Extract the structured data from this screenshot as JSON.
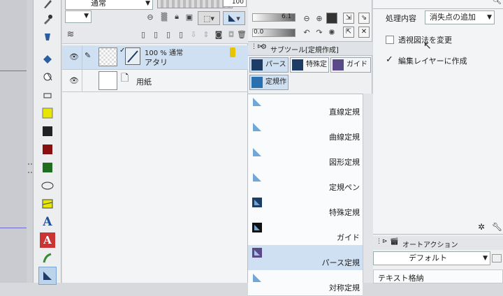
{
  "layers_panel": {
    "blend_mode": "通常",
    "opacity_value": "100",
    "layers": [
      {
        "percent_mode": "100 % 通常",
        "name": "アタリ",
        "selected": true
      },
      {
        "name": "用紙",
        "selected": false
      }
    ]
  },
  "subtool_panel": {
    "slider_value": "6.1",
    "slider2_value": "0.0",
    "header": "サブツール[定規作成]",
    "groups": [
      {
        "label": "パース",
        "selected": true
      },
      {
        "label": "特殊定",
        "selected": false
      },
      {
        "label": "ガイド",
        "selected": false
      },
      {
        "label": "定規作",
        "selected": true
      }
    ],
    "items": [
      {
        "label": "直線定規",
        "selected": false,
        "icon": "ruler-straight-icon"
      },
      {
        "label": "曲線定規",
        "selected": false,
        "icon": "ruler-curve-icon"
      },
      {
        "label": "図形定規",
        "selected": false,
        "icon": "ruler-figure-icon"
      },
      {
        "label": "定規ペン",
        "selected": false,
        "icon": "ruler-pen-icon"
      },
      {
        "label": "特殊定規",
        "selected": false,
        "icon": "special-ruler-icon"
      },
      {
        "label": "ガイド",
        "selected": false,
        "icon": "guide-icon"
      },
      {
        "label": "パース定規",
        "selected": true,
        "icon": "perspective-ruler-icon"
      },
      {
        "label": "対称定規",
        "selected": false,
        "icon": "symmetry-ruler-icon"
      }
    ]
  },
  "tool_properties": {
    "process_label": "処理内容",
    "process_value": "消失点の追加",
    "option1": {
      "label": "透視図法を変更",
      "checked": false
    },
    "option2": {
      "label": "編集レイヤーに作成",
      "checked": true
    }
  },
  "auto_action": {
    "tab_label": "オートアクション",
    "set_value": "デフォルト",
    "items": [
      "テキスト格納"
    ]
  },
  "colors": {
    "selection": "#cfe0f2",
    "ruler_icon": "#1d3d66",
    "panel_bg": "#f3f4f6"
  }
}
